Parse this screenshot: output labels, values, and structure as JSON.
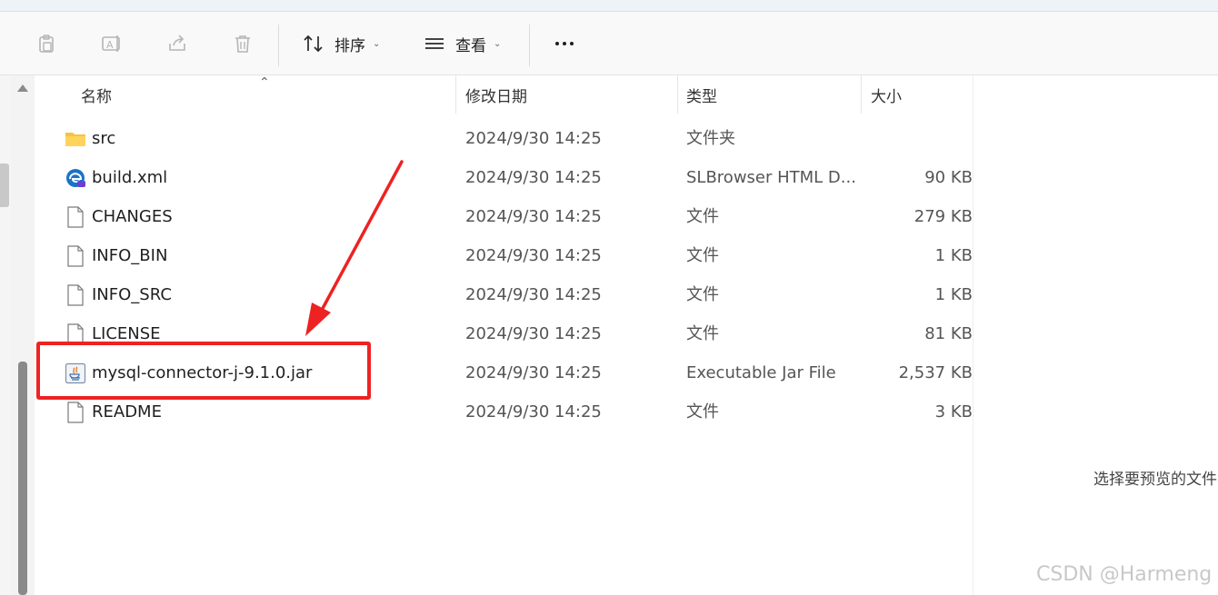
{
  "toolbar": {
    "sort_label": "排序",
    "view_label": "查看"
  },
  "columns": {
    "name": "名称",
    "date": "修改日期",
    "type": "类型",
    "size": "大小"
  },
  "files": [
    {
      "name": "src",
      "date": "2024/9/30 14:25",
      "type": "文件夹",
      "size": "",
      "icon": "folder-icon"
    },
    {
      "name": "build.xml",
      "date": "2024/9/30 14:25",
      "type": "SLBrowser HTML D...",
      "size": "90 KB",
      "icon": "browser-file-icon"
    },
    {
      "name": "CHANGES",
      "date": "2024/9/30 14:25",
      "type": "文件",
      "size": "279 KB",
      "icon": "file-icon"
    },
    {
      "name": "INFO_BIN",
      "date": "2024/9/30 14:25",
      "type": "文件",
      "size": "1 KB",
      "icon": "file-icon"
    },
    {
      "name": "INFO_SRC",
      "date": "2024/9/30 14:25",
      "type": "文件",
      "size": "1 KB",
      "icon": "file-icon"
    },
    {
      "name": "LICENSE",
      "date": "2024/9/30 14:25",
      "type": "文件",
      "size": "81 KB",
      "icon": "file-icon"
    },
    {
      "name": "mysql-connector-j-9.1.0.jar",
      "date": "2024/9/30 14:25",
      "type": "Executable Jar File",
      "size": "2,537 KB",
      "icon": "java-jar-icon"
    },
    {
      "name": "README",
      "date": "2024/9/30 14:25",
      "type": "文件",
      "size": "3 KB",
      "icon": "file-icon"
    }
  ],
  "preview": {
    "message": "选择要预览的文件"
  },
  "watermark": "CSDN @Harmeng",
  "colors": {
    "highlight": "#ee2222",
    "folder": "#f5c242",
    "accent": "#1a73c8"
  }
}
